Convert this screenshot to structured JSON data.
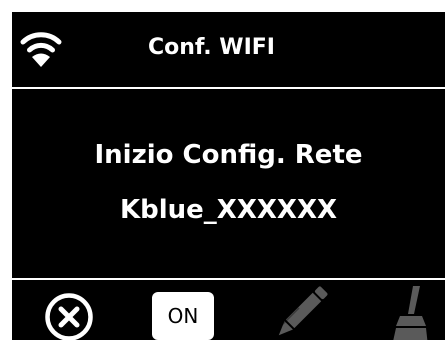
{
  "header": {
    "title": "Conf. WIFI",
    "icon": "wifi-icon"
  },
  "message": {
    "line1": "Inizio Config. Rete",
    "line2": "Kblue_XXXXXX"
  },
  "toolbar": {
    "close_icon": "close-circle-icon",
    "on_label": "ON",
    "edit_icon": "pencil-icon",
    "clear_icon": "broom-icon",
    "disabled_color": "#5a5a5a"
  },
  "colors": {
    "background": "#000000",
    "foreground": "#ffffff"
  }
}
